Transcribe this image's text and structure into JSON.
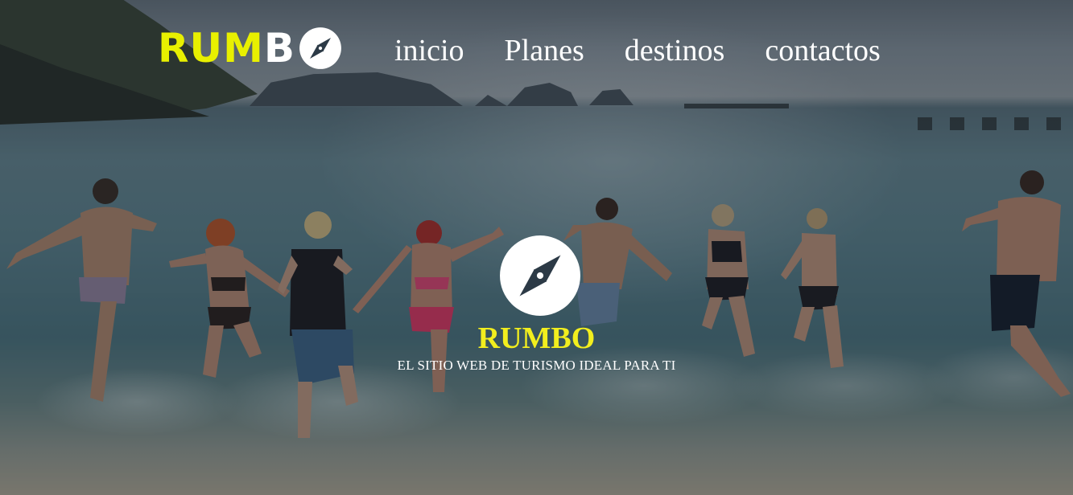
{
  "brand": {
    "logo_yellow": "RUM",
    "logo_white": "B",
    "compass_icon": "compass-icon",
    "colors": {
      "yellow": "#e8f000",
      "white": "#ffffff"
    }
  },
  "nav": {
    "items": [
      {
        "label": "inicio"
      },
      {
        "label": "Planes"
      },
      {
        "label": "destinos"
      },
      {
        "label": "contactos"
      }
    ]
  },
  "hero": {
    "title": "RUMBO",
    "subtitle": "EL SITIO WEB DE TURISMO IDEAL PARA TI",
    "icon": "compass-icon",
    "title_color": "#f2ee1e"
  }
}
